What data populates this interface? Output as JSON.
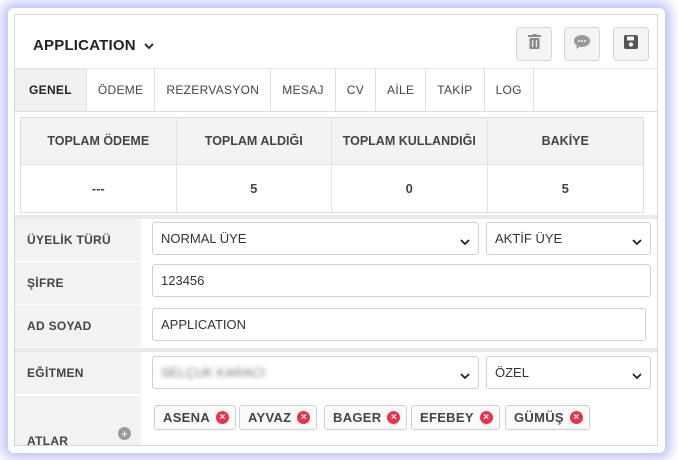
{
  "header": {
    "title": "APPLICATION"
  },
  "toolbar": {
    "delete_icon": "trash-icon",
    "comment_icon": "comment-icon",
    "save_icon": "save-icon"
  },
  "tabs": [
    {
      "label": "GENEL",
      "active": true
    },
    {
      "label": "ÖDEME"
    },
    {
      "label": "REZERVASYON"
    },
    {
      "label": "MESAJ"
    },
    {
      "label": "CV"
    },
    {
      "label": "AİLE"
    },
    {
      "label": "TAKİP"
    },
    {
      "label": "LOG"
    }
  ],
  "stats": {
    "headers": [
      "TOPLAM ÖDEME",
      "TOPLAM ALDIĞI",
      "TOPLAM KULLANDIĞI",
      "BAKİYE"
    ],
    "values": [
      "---",
      "5",
      "0",
      "5"
    ]
  },
  "form": {
    "membership": {
      "label": "ÜYELİK TÜRÜ",
      "type_value": "NORMAL ÜYE",
      "status_value": "AKTİF ÜYE"
    },
    "password": {
      "label": "ŞİFRE",
      "value": "123456"
    },
    "name": {
      "label": "AD SOYAD",
      "value": "APPLICATION"
    },
    "trainer": {
      "label": "EĞİTMEN",
      "value": "SELÇUK KARACI",
      "type_value": "ÖZEL"
    },
    "horses": {
      "label": "ATLAR",
      "items": [
        "ASENA",
        "AYVAZ",
        "BAGER",
        "EFEBEY",
        "GÜMÜŞ"
      ]
    }
  },
  "colors": {
    "accent_glow": "#6e78f0",
    "remove_badge": "#e8334a"
  }
}
